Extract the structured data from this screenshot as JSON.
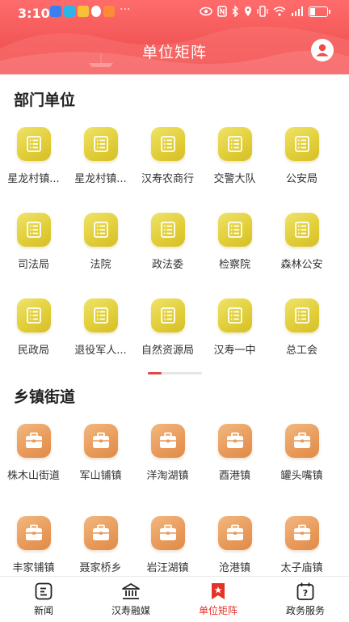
{
  "status_bar": {
    "time": "3:10",
    "more": "···"
  },
  "header": {
    "title": "单位矩阵"
  },
  "sections": [
    {
      "title": "部门单位",
      "icon": "list-icon",
      "items": [
        {
          "label": "星龙村镇..."
        },
        {
          "label": "星龙村镇..."
        },
        {
          "label": "汉寿农商行"
        },
        {
          "label": "交警大队"
        },
        {
          "label": "公安局"
        },
        {
          "label": "司法局"
        },
        {
          "label": "法院"
        },
        {
          "label": "政法委"
        },
        {
          "label": "检察院"
        },
        {
          "label": "森林公安"
        },
        {
          "label": "民政局"
        },
        {
          "label": "退役军人..."
        },
        {
          "label": "自然资源局"
        },
        {
          "label": "汉寿一中"
        },
        {
          "label": "总工会"
        }
      ]
    },
    {
      "title": "乡镇街道",
      "icon": "briefcase-icon",
      "items": [
        {
          "label": "株木山街道"
        },
        {
          "label": "军山铺镇"
        },
        {
          "label": "洋淘湖镇"
        },
        {
          "label": "酉港镇"
        },
        {
          "label": "罐头嘴镇"
        },
        {
          "label": "丰家铺镇"
        },
        {
          "label": "聂家桥乡"
        },
        {
          "label": "岩汪湖镇"
        },
        {
          "label": "沧港镇"
        },
        {
          "label": "太子庙镇"
        }
      ]
    }
  ],
  "pager": {
    "current": 1,
    "pages": 4
  },
  "tabbar": {
    "tabs": [
      {
        "label": "新闻",
        "icon": "news-icon"
      },
      {
        "label": "汉寿融媒",
        "icon": "building-icon"
      },
      {
        "label": "单位矩阵",
        "icon": "ribbon-star-icon",
        "active": true
      },
      {
        "label": "政务服务",
        "icon": "calendar-question-icon"
      }
    ]
  },
  "colors": {
    "accent": "#e5332a",
    "header": "#f25656",
    "dept_tile": "#e2cf3a",
    "town_tile": "#e89a5a"
  }
}
